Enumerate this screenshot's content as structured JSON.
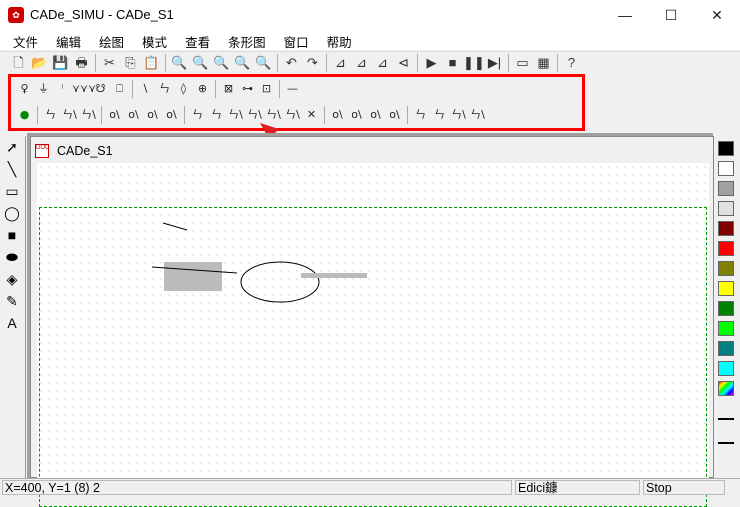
{
  "window": {
    "title": "CADe_SIMU - CADe_S1",
    "min": "—",
    "max": "☐",
    "close": "✕"
  },
  "menu": [
    "文件",
    "编辑",
    "绘图",
    "模式",
    "查看",
    "条形图",
    "窗口",
    "帮助"
  ],
  "toolbar": [
    "🗋",
    "📂",
    "💾",
    "🖶",
    "|",
    "✂",
    "⎘",
    "📋",
    "|",
    "🔍",
    "🔍",
    "🔍",
    "🔍",
    "🔍",
    "|",
    "↶",
    "↷",
    "|",
    "⊿",
    "⊿",
    "⊿",
    "⊲",
    "|",
    "▶",
    "■",
    "❚❚",
    "▶|",
    "|",
    "▭",
    "▦",
    "|",
    "?"
  ],
  "tools_row1": [
    "♀",
    "⏚",
    "ᛌ",
    "⋎⋎⋎",
    "☋",
    "⎕",
    "|",
    "\\",
    "ㄣ",
    "◊",
    "⊕",
    "|",
    "⊠",
    "⊶",
    "⊡",
    "|",
    "—"
  ],
  "tools_row2": [
    "●",
    "|",
    "ㄣ",
    "ㄣ\\",
    "ㄣ\\",
    "|",
    "о\\",
    "о\\",
    "о\\",
    "о\\",
    "|",
    "ㄣ",
    "ㄣ",
    "ㄣ\\",
    "ㄣ\\",
    "ㄣ\\",
    "ㄣ\\",
    "✕",
    "|",
    "о\\",
    "о\\",
    "о\\",
    "о\\",
    "|",
    "ㄣ",
    "ㄣ",
    "ㄣ\\",
    "ㄣ\\"
  ],
  "toolbox": [
    "➚",
    "╲",
    "▭",
    "◯",
    "■",
    "⬬",
    "◈",
    "✎",
    "A"
  ],
  "child": {
    "title": "CADe_S1",
    "icon": "DOC"
  },
  "palette": [
    "#000000",
    "#ffffff",
    "#a0a0a0",
    "#e0e0e0",
    "#800000",
    "#ff0000",
    "#808000",
    "#ffff00",
    "#008000",
    "#00ff00",
    "#008080",
    "#00ffff",
    "multi"
  ],
  "status": {
    "coords": "X=400, Y=1 (8) 2",
    "mode": "Edici鏮",
    "state": "Stop"
  },
  "colors": {
    "highlight": "#ff0000"
  }
}
